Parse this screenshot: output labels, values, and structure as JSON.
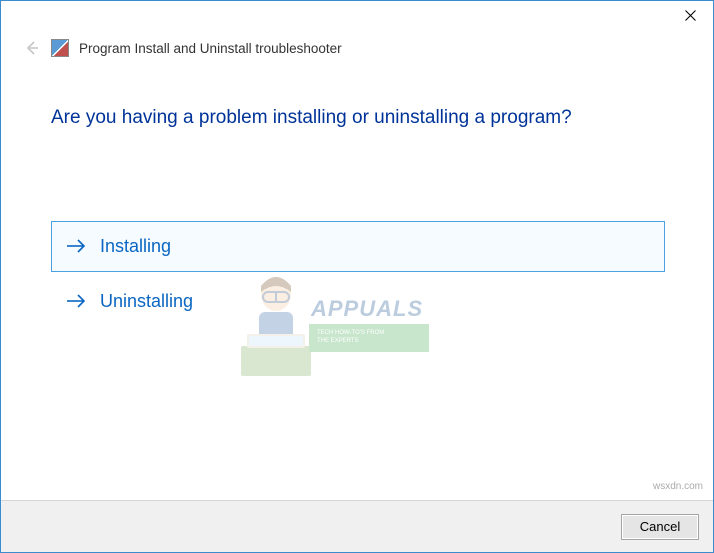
{
  "header": {
    "title": "Program Install and Uninstall troubleshooter"
  },
  "main": {
    "heading": "Are you having a problem installing or uninstalling a program?",
    "options": [
      {
        "label": "Installing",
        "selected": true
      },
      {
        "label": "Uninstalling",
        "selected": false
      }
    ]
  },
  "footer": {
    "cancel": "Cancel"
  },
  "watermark": {
    "brand": "APPUALS",
    "tagline1": "TECH HOW-TO'S FROM",
    "tagline2": "THE EXPERTS",
    "source": "wsxdn.com"
  }
}
